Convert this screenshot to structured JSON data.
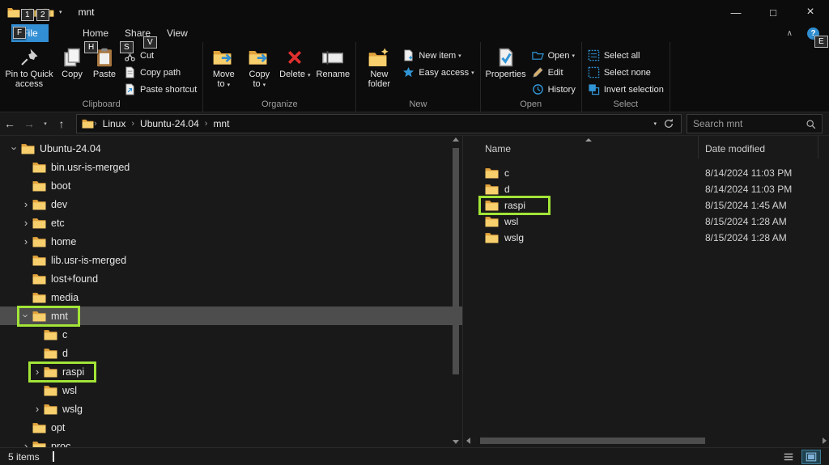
{
  "window": {
    "title": "mnt"
  },
  "glyphs": {
    "minimize": "—",
    "maximize": "□",
    "close": "×",
    "dropdown": "▾",
    "chevron": "›",
    "back": "←",
    "forward": "→",
    "up": "↑",
    "collapse_ribbon": "∧",
    "help": "?",
    "crumb_separator": "›"
  },
  "keytips": {
    "qat1": "1",
    "qat2": "2",
    "file": "F",
    "home": "H",
    "share": "S",
    "view": "V",
    "help": "E"
  },
  "tabs": {
    "file": "File",
    "home": "Home",
    "share": "Share",
    "view": "View"
  },
  "ribbon": {
    "clipboard": {
      "label": "Clipboard",
      "pin": "Pin to Quick access",
      "copy": "Copy",
      "paste": "Paste",
      "cut": "Cut",
      "copy_path": "Copy path",
      "paste_shortcut": "Paste shortcut"
    },
    "organize": {
      "label": "Organize",
      "move_to": "Move to",
      "copy_to": "Copy to",
      "delete": "Delete",
      "rename": "Rename"
    },
    "new_group": {
      "label": "New",
      "new_folder": "New folder",
      "new_item": "New item",
      "easy_access": "Easy access"
    },
    "open_group": {
      "label": "Open",
      "properties": "Properties",
      "open": "Open",
      "edit": "Edit",
      "history": "History"
    },
    "select_group": {
      "label": "Select",
      "select_all": "Select all",
      "select_none": "Select none",
      "invert_selection": "Invert selection"
    }
  },
  "addressbar": {
    "crumbs": [
      "Linux",
      "Ubuntu-24.04",
      "mnt"
    ],
    "search_placeholder": "Search mnt"
  },
  "tree": {
    "items": [
      {
        "label": "Ubuntu-24.04"
      },
      {
        "label": "bin.usr-is-merged"
      },
      {
        "label": "boot"
      },
      {
        "label": "dev"
      },
      {
        "label": "etc"
      },
      {
        "label": "home"
      },
      {
        "label": "lib.usr-is-merged"
      },
      {
        "label": "lost+found"
      },
      {
        "label": "media"
      },
      {
        "label": "mnt"
      },
      {
        "label": "c"
      },
      {
        "label": "d"
      },
      {
        "label": "raspi"
      },
      {
        "label": "wsl"
      },
      {
        "label": "wslg"
      },
      {
        "label": "opt"
      },
      {
        "label": "proc"
      }
    ]
  },
  "list": {
    "columns": [
      "Name",
      "Date modified"
    ],
    "rows": [
      {
        "name": "c",
        "date": "8/14/2024 11:03 PM"
      },
      {
        "name": "d",
        "date": "8/14/2024 11:03 PM"
      },
      {
        "name": "raspi",
        "date": "8/15/2024 1:45 AM"
      },
      {
        "name": "wsl",
        "date": "8/15/2024 1:28 AM"
      },
      {
        "name": "wslg",
        "date": "8/15/2024 1:28 AM"
      }
    ]
  },
  "statusbar": {
    "items_count": "5 items"
  },
  "colors": {
    "highlight_green": "#a2e437",
    "accent_blue": "#3095d6",
    "file_tab_blue": "#338fd4",
    "folder_yellow": "#f7cf6d",
    "selected_row": "#4d4d4d"
  }
}
